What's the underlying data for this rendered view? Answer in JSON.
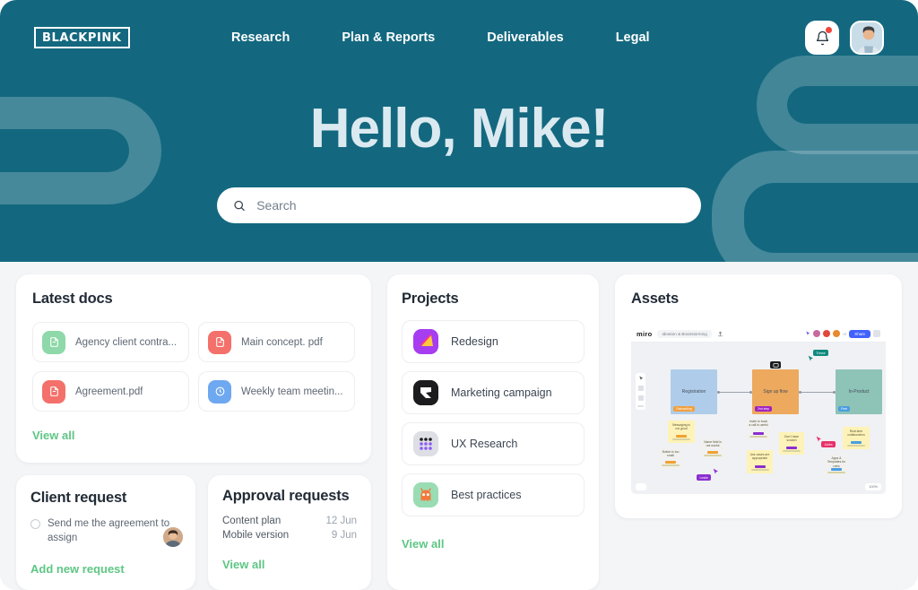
{
  "header": {
    "logo_text": "BLACKPINK",
    "nav": [
      {
        "label": "Research"
      },
      {
        "label": "Plan & Reports"
      },
      {
        "label": "Deliverables"
      },
      {
        "label": "Legal"
      }
    ],
    "bell_icon": "bell-icon",
    "avatar_icon": "user-avatar"
  },
  "hero": {
    "title": "Hello, Mike!",
    "search_placeholder": "Search",
    "search_value": "",
    "search_icon": "search-icon",
    "bg_color": "#13687f"
  },
  "latest_docs": {
    "title": "Latest docs",
    "view_all": "View all",
    "items": [
      {
        "name": "Agency client contra...",
        "icon": "document-icon",
        "color": "#8ed8a9"
      },
      {
        "name": "Main concept. pdf",
        "icon": "document-icon",
        "color": "#f4706b"
      },
      {
        "name": "Agreement.pdf",
        "icon": "document-icon",
        "color": "#f4706b"
      },
      {
        "name": "Weekly team meetin...",
        "icon": "clock-icon",
        "color": "#6ea8f0"
      }
    ]
  },
  "client_request": {
    "title": "Client request",
    "item_text": "Send me the agreement to assign",
    "add_label": "Add new request",
    "checkbox_icon": "radio-unchecked-icon",
    "avatar_icon": "requester-avatar"
  },
  "approval_requests": {
    "title": "Approval requests",
    "view_all": "View all",
    "items": [
      {
        "name": "Content plan",
        "date": "12 Jun"
      },
      {
        "name": "Mobile version",
        "date": "9 Jun"
      }
    ]
  },
  "projects": {
    "title": "Projects",
    "view_all": "View all",
    "items": [
      {
        "name": "Redesign",
        "icon": "figma-like-icon",
        "color": "#a855f7"
      },
      {
        "name": "Marketing campaign",
        "icon": "framer-like-icon",
        "color": "#1c1c1e"
      },
      {
        "name": "UX Research",
        "icon": "dots-grid-icon",
        "color": "#dcdde2"
      },
      {
        "name": "Best practices",
        "icon": "mascot-icon",
        "color": "#9adcb4"
      }
    ]
  },
  "assets": {
    "title": "Assets",
    "board": {
      "app_name": "miro",
      "board_title": "Ideation & Brainstorming",
      "share_label": "Share",
      "zoom_level": "100%",
      "nodes": [
        {
          "label": "Registration",
          "tag": "Onboarding",
          "color": "#afcdea",
          "tag_color": "#f29f3d"
        },
        {
          "label": "Sign up flow",
          "tag": "2nd step",
          "color": "#eda95e",
          "tag_color": "#a020c0"
        },
        {
          "label": "In-Product",
          "tag": "Free",
          "color": "#8ec3b8",
          "tag_color": "#4a9ee0"
        }
      ],
      "stickies": [
        {
          "text": "Messaging is not good",
          "tag_color": "#f0a030"
        },
        {
          "text": "Button is too small",
          "tag_color": "#f0a030"
        },
        {
          "text": "Name field is not useful",
          "tag_color": "#f0a030"
        },
        {
          "text": "Invite to book a call is useful",
          "tag_color": "#8b2ed0"
        },
        {
          "text": "Use cases are appropriate",
          "tag_color": "#8b2ed0"
        },
        {
          "text": "Don't have scratch",
          "tag_color": "#8b2ed0"
        },
        {
          "text": "Real-time collaboration",
          "tag_color": "#4a9ee0"
        },
        {
          "text": "Apps & Templates for roles",
          "tag_color": "#4a9ee0"
        }
      ],
      "cursors": [
        {
          "name": "Trevor",
          "color": "#0f8a7e"
        },
        {
          "name": "Julies",
          "color": "#e8316a"
        },
        {
          "name": "Leslie",
          "color": "#8b2ed0"
        }
      ]
    }
  },
  "theme": {
    "accent_green": "#5ec684",
    "teal": "#13687f",
    "page_bg": "#f4f5f7"
  }
}
